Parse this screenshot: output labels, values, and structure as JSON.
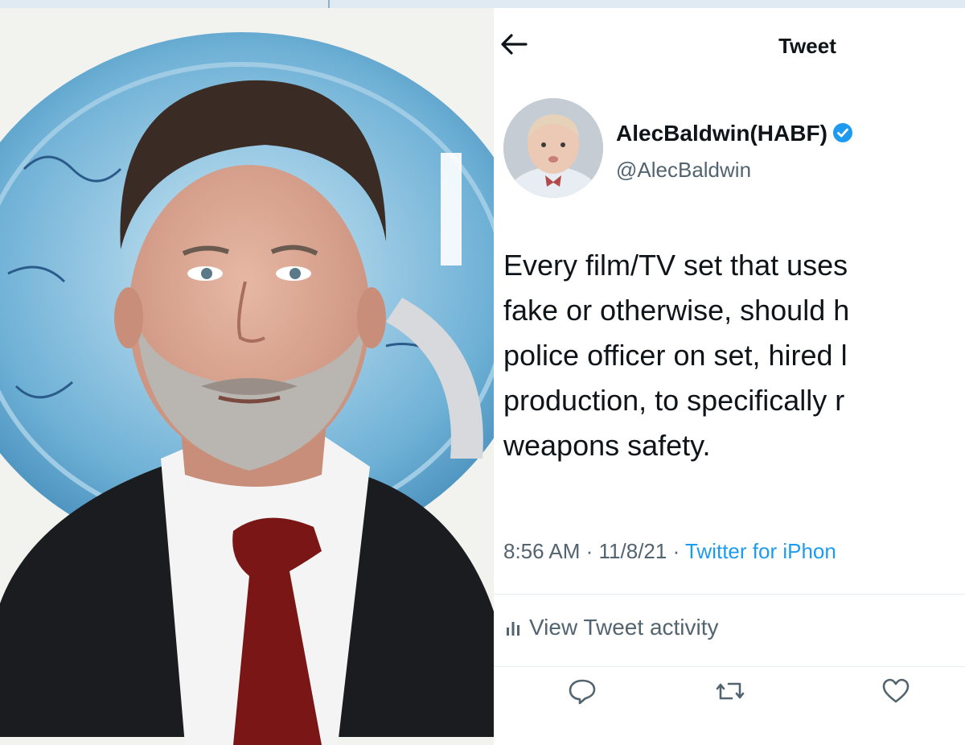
{
  "header": {
    "title": "Tweet"
  },
  "author": {
    "display_name": "AlecBaldwin(HABF)",
    "handle": "@AlecBaldwin"
  },
  "tweet": {
    "lines": [
      "Every film/TV set that uses",
      "fake or otherwise, should h",
      "police officer on set, hired l",
      "production, to specifically r",
      "weapons safety."
    ]
  },
  "meta": {
    "time": "8:56 AM",
    "separator1": " · ",
    "date": "11/8/21",
    "separator2": " · ",
    "source": "Twitter for iPhon"
  },
  "activity": {
    "label": "View Tweet activity"
  },
  "actions": [
    "reply-icon",
    "retweet-icon",
    "like-icon"
  ],
  "colors": {
    "link": "#1d9bf0",
    "verified": "#1d9bf0",
    "tie": "#7a1616",
    "suit": "#1b1c20"
  }
}
